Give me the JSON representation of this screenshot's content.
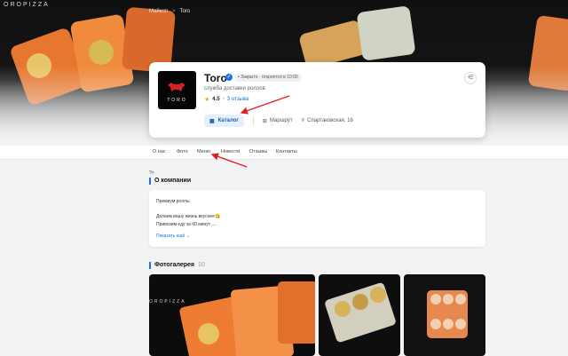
{
  "hero": {
    "brand_text": "OROPIZZA"
  },
  "breadcrumb": {
    "items": [
      "Майкоп",
      "Toro"
    ],
    "separator": ">"
  },
  "profile": {
    "logo_text": "TORO",
    "name": "Toro",
    "status": "• Закрыто · откроется в 10:00",
    "description": "служба доставки роллов",
    "rating": "4.5",
    "reviews": "3 отзыва",
    "catalog_button": "Каталог",
    "route_label": "Маршрут",
    "address": "Спартаковская, 16"
  },
  "tabs": [
    "О нас",
    "Фото",
    "Меню",
    "Новости",
    "Отзывы",
    "Контакты"
  ],
  "about": {
    "prev_marker": "?>",
    "title": "О компании",
    "lines": [
      "Премиум роллы",
      "Делаем вашу жизнь вкуснее😋",
      "Привозим еду за 60 минут ...."
    ],
    "show_more": "Показать ещё ⌄"
  },
  "gallery": {
    "title": "Фотогалерея",
    "count": "10",
    "photo_text": "OROPIZZA"
  },
  "colors": {
    "accent": "#1a73e8",
    "annotation": "#e02020",
    "salmon": "#f07a2e",
    "dark": "#0c0c0c"
  }
}
